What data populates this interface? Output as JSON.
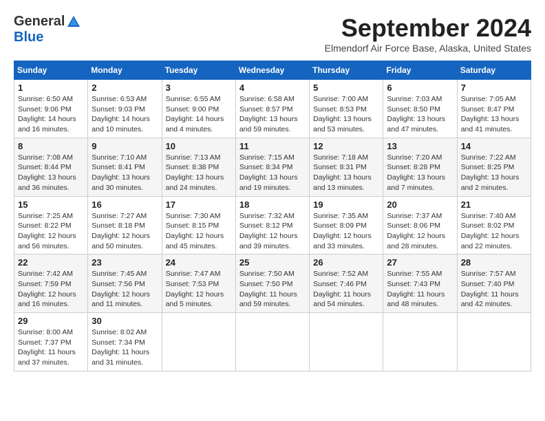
{
  "logo": {
    "line1": "General",
    "line2": "Blue"
  },
  "title": "September 2024",
  "subtitle": "Elmendorf Air Force Base, Alaska, United States",
  "weekdays": [
    "Sunday",
    "Monday",
    "Tuesday",
    "Wednesday",
    "Thursday",
    "Friday",
    "Saturday"
  ],
  "weeks": [
    [
      {
        "day": "1",
        "info": "Sunrise: 6:50 AM\nSunset: 9:06 PM\nDaylight: 14 hours\nand 16 minutes."
      },
      {
        "day": "2",
        "info": "Sunrise: 6:53 AM\nSunset: 9:03 PM\nDaylight: 14 hours\nand 10 minutes."
      },
      {
        "day": "3",
        "info": "Sunrise: 6:55 AM\nSunset: 9:00 PM\nDaylight: 14 hours\nand 4 minutes."
      },
      {
        "day": "4",
        "info": "Sunrise: 6:58 AM\nSunset: 8:57 PM\nDaylight: 13 hours\nand 59 minutes."
      },
      {
        "day": "5",
        "info": "Sunrise: 7:00 AM\nSunset: 8:53 PM\nDaylight: 13 hours\nand 53 minutes."
      },
      {
        "day": "6",
        "info": "Sunrise: 7:03 AM\nSunset: 8:50 PM\nDaylight: 13 hours\nand 47 minutes."
      },
      {
        "day": "7",
        "info": "Sunrise: 7:05 AM\nSunset: 8:47 PM\nDaylight: 13 hours\nand 41 minutes."
      }
    ],
    [
      {
        "day": "8",
        "info": "Sunrise: 7:08 AM\nSunset: 8:44 PM\nDaylight: 13 hours\nand 36 minutes."
      },
      {
        "day": "9",
        "info": "Sunrise: 7:10 AM\nSunset: 8:41 PM\nDaylight: 13 hours\nand 30 minutes."
      },
      {
        "day": "10",
        "info": "Sunrise: 7:13 AM\nSunset: 8:38 PM\nDaylight: 13 hours\nand 24 minutes."
      },
      {
        "day": "11",
        "info": "Sunrise: 7:15 AM\nSunset: 8:34 PM\nDaylight: 13 hours\nand 19 minutes."
      },
      {
        "day": "12",
        "info": "Sunrise: 7:18 AM\nSunset: 8:31 PM\nDaylight: 13 hours\nand 13 minutes."
      },
      {
        "day": "13",
        "info": "Sunrise: 7:20 AM\nSunset: 8:28 PM\nDaylight: 13 hours\nand 7 minutes."
      },
      {
        "day": "14",
        "info": "Sunrise: 7:22 AM\nSunset: 8:25 PM\nDaylight: 13 hours\nand 2 minutes."
      }
    ],
    [
      {
        "day": "15",
        "info": "Sunrise: 7:25 AM\nSunset: 8:22 PM\nDaylight: 12 hours\nand 56 minutes."
      },
      {
        "day": "16",
        "info": "Sunrise: 7:27 AM\nSunset: 8:18 PM\nDaylight: 12 hours\nand 50 minutes."
      },
      {
        "day": "17",
        "info": "Sunrise: 7:30 AM\nSunset: 8:15 PM\nDaylight: 12 hours\nand 45 minutes."
      },
      {
        "day": "18",
        "info": "Sunrise: 7:32 AM\nSunset: 8:12 PM\nDaylight: 12 hours\nand 39 minutes."
      },
      {
        "day": "19",
        "info": "Sunrise: 7:35 AM\nSunset: 8:09 PM\nDaylight: 12 hours\nand 33 minutes."
      },
      {
        "day": "20",
        "info": "Sunrise: 7:37 AM\nSunset: 8:06 PM\nDaylight: 12 hours\nand 28 minutes."
      },
      {
        "day": "21",
        "info": "Sunrise: 7:40 AM\nSunset: 8:02 PM\nDaylight: 12 hours\nand 22 minutes."
      }
    ],
    [
      {
        "day": "22",
        "info": "Sunrise: 7:42 AM\nSunset: 7:59 PM\nDaylight: 12 hours\nand 16 minutes."
      },
      {
        "day": "23",
        "info": "Sunrise: 7:45 AM\nSunset: 7:56 PM\nDaylight: 12 hours\nand 11 minutes."
      },
      {
        "day": "24",
        "info": "Sunrise: 7:47 AM\nSunset: 7:53 PM\nDaylight: 12 hours\nand 5 minutes."
      },
      {
        "day": "25",
        "info": "Sunrise: 7:50 AM\nSunset: 7:50 PM\nDaylight: 11 hours\nand 59 minutes."
      },
      {
        "day": "26",
        "info": "Sunrise: 7:52 AM\nSunset: 7:46 PM\nDaylight: 11 hours\nand 54 minutes."
      },
      {
        "day": "27",
        "info": "Sunrise: 7:55 AM\nSunset: 7:43 PM\nDaylight: 11 hours\nand 48 minutes."
      },
      {
        "day": "28",
        "info": "Sunrise: 7:57 AM\nSunset: 7:40 PM\nDaylight: 11 hours\nand 42 minutes."
      }
    ],
    [
      {
        "day": "29",
        "info": "Sunrise: 8:00 AM\nSunset: 7:37 PM\nDaylight: 11 hours\nand 37 minutes."
      },
      {
        "day": "30",
        "info": "Sunrise: 8:02 AM\nSunset: 7:34 PM\nDaylight: 11 hours\nand 31 minutes."
      },
      {
        "day": "",
        "info": ""
      },
      {
        "day": "",
        "info": ""
      },
      {
        "day": "",
        "info": ""
      },
      {
        "day": "",
        "info": ""
      },
      {
        "day": "",
        "info": ""
      }
    ]
  ]
}
